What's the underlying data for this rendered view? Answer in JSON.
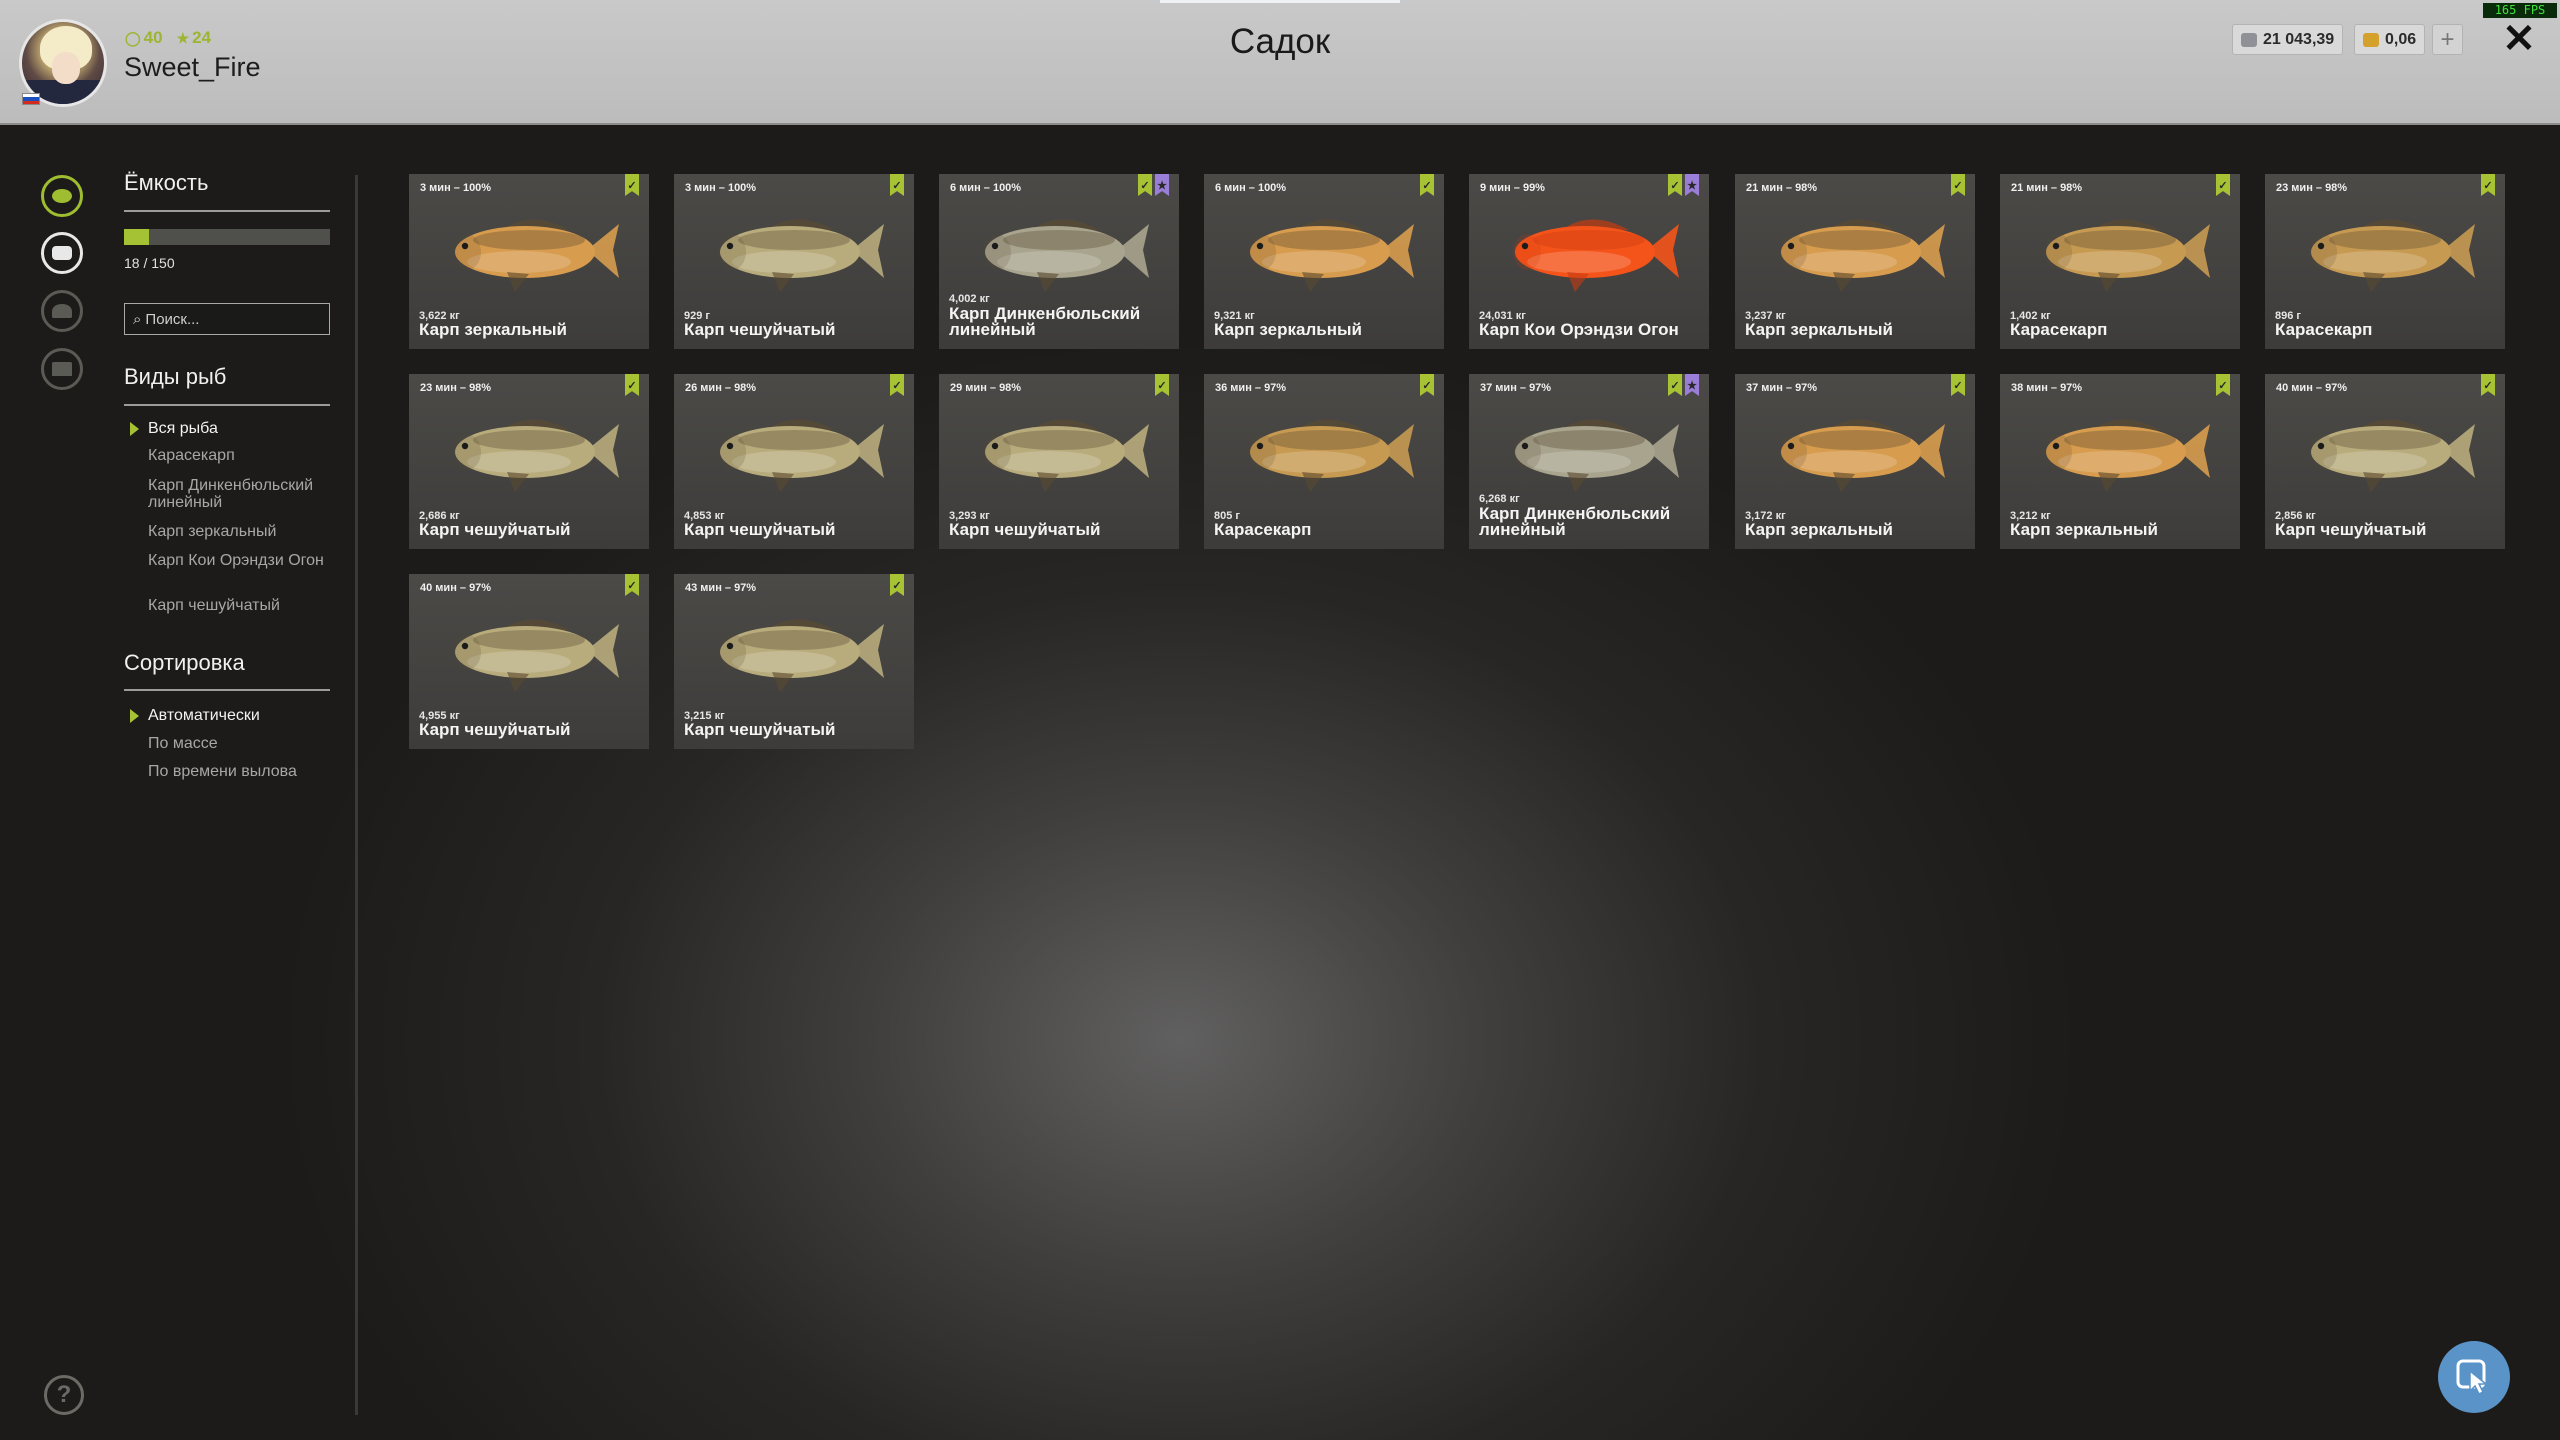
{
  "header": {
    "title": "Садок",
    "player_name": "Sweet_Fire",
    "level": "40",
    "rank": "24",
    "silver": "21 043,39",
    "gold": "0,06",
    "add_label": "+",
    "close_label": "✕",
    "fps": "165 FPS",
    "colors": {
      "accent": "#a4c234",
      "header_bg": "#c4c4c4"
    }
  },
  "sidebar": {
    "capacity_title": "Ёмкость",
    "capacity_text": "18 / 150",
    "capacity_used": 18,
    "capacity_max": 150,
    "search_placeholder": "Поиск...",
    "species_title": "Виды рыб",
    "species": [
      {
        "label": "Вся рыба",
        "selected": true
      },
      {
        "label": "Карасекарп",
        "selected": false
      },
      {
        "label": "Карп Динкенбюльский линейный",
        "selected": false
      },
      {
        "label": "Карп зеркальный",
        "selected": false
      },
      {
        "label": "Карп Кои Орэндзи Огон",
        "selected": false
      },
      {
        "label": "Карп чешуйчатый",
        "selected": false
      }
    ],
    "sort_title": "Сортировка",
    "sort_options": [
      {
        "label": "Автоматически",
        "selected": true
      },
      {
        "label": "По массе",
        "selected": false
      },
      {
        "label": "По времени вылова",
        "selected": false
      }
    ]
  },
  "fish": [
    {
      "time": "3 мин – 100%",
      "weight": "3,622 кг",
      "name": "Карп зеркальный",
      "type": "mirror",
      "badges": [
        "green"
      ]
    },
    {
      "time": "3 мин – 100%",
      "weight": "929 г",
      "name": "Карп чешуйчатый",
      "type": "common",
      "badges": [
        "green"
      ]
    },
    {
      "time": "6 мин – 100%",
      "weight": "4,002 кг",
      "name": "Карп Динкенбюльский линейный",
      "type": "linear",
      "badges": [
        "green",
        "purple"
      ]
    },
    {
      "time": "6 мин – 100%",
      "weight": "9,321 кг",
      "name": "Карп зеркальный",
      "type": "mirror",
      "badges": [
        "green"
      ]
    },
    {
      "time": "9 мин – 99%",
      "weight": "24,031 кг",
      "name": "Карп Кои Орэндзи Огон",
      "type": "koi",
      "badges": [
        "green",
        "purple"
      ]
    },
    {
      "time": "21 мин – 98%",
      "weight": "3,237 кг",
      "name": "Карп зеркальный",
      "type": "mirror",
      "badges": [
        "green"
      ]
    },
    {
      "time": "21 мин – 98%",
      "weight": "1,402 кг",
      "name": "Карасекарп",
      "type": "crucian",
      "badges": [
        "green"
      ]
    },
    {
      "time": "23 мин – 98%",
      "weight": "896 г",
      "name": "Карасекарп",
      "type": "crucian",
      "badges": [
        "green"
      ]
    },
    {
      "time": "23 мин – 98%",
      "weight": "2,686 кг",
      "name": "Карп чешуйчатый",
      "type": "common",
      "badges": [
        "green"
      ]
    },
    {
      "time": "26 мин – 98%",
      "weight": "4,853 кг",
      "name": "Карп чешуйчатый",
      "type": "common",
      "badges": [
        "green"
      ]
    },
    {
      "time": "29 мин – 98%",
      "weight": "3,293 кг",
      "name": "Карп чешуйчатый",
      "type": "common",
      "badges": [
        "green"
      ]
    },
    {
      "time": "36 мин – 97%",
      "weight": "805 г",
      "name": "Карасекарп",
      "type": "crucian",
      "badges": [
        "green"
      ]
    },
    {
      "time": "37 мин – 97%",
      "weight": "6,268 кг",
      "name": "Карп Динкенбюльский линейный",
      "type": "linear",
      "badges": [
        "green",
        "purple"
      ]
    },
    {
      "time": "37 мин – 97%",
      "weight": "3,172 кг",
      "name": "Карп зеркальный",
      "type": "mirror",
      "badges": [
        "green"
      ]
    },
    {
      "time": "38 мин – 97%",
      "weight": "3,212 кг",
      "name": "Карп зеркальный",
      "type": "mirror",
      "badges": [
        "green"
      ]
    },
    {
      "time": "40 мин – 97%",
      "weight": "2,856 кг",
      "name": "Карп чешуйчатый",
      "type": "common",
      "badges": [
        "green"
      ]
    },
    {
      "time": "40 мин – 97%",
      "weight": "4,955 кг",
      "name": "Карп чешуйчатый",
      "type": "common",
      "badges": [
        "green"
      ]
    },
    {
      "time": "43 мин – 97%",
      "weight": "3,215 кг",
      "name": "Карп чешуйчатый",
      "type": "common",
      "badges": [
        "green"
      ]
    }
  ],
  "fish_colors": {
    "mirror": "#d79c4e",
    "common": "#b8ab7c",
    "crucian": "#c79a52",
    "linear": "#a8a48e",
    "koi": "#f4541a"
  },
  "help_label": "?"
}
